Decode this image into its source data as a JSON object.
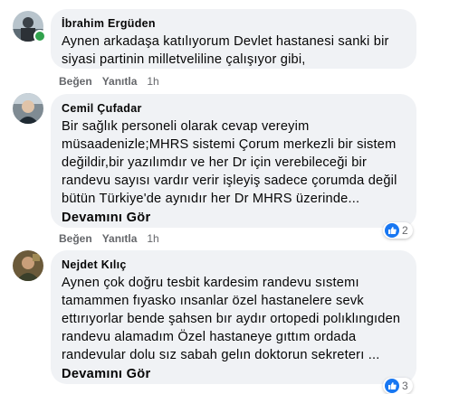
{
  "comments": [
    {
      "author": "İbrahim Ergüden",
      "text": "Aynen arkadaşa katılıyorum Devlet hastanesi sanki bir\nsiyasi partinin milletveliline çalışıyor gibi,",
      "like_label": "Beğen",
      "reply_label": "Yanıtla",
      "time": "1h",
      "online": true
    },
    {
      "author": "Cemil Çufadar",
      "text": "Bir sağlık personeli olarak cevap vereyim\nmüsaadenizle;MHRS sistemi Çorum merkezli bir sistem\ndeğildir,bir yazılımdır ve her Dr için verebileceği bir\nrandevu sayısı vardır verir işleyiş sadece çorumda değil\nbütün Türkiye'de aynıdır her Dr MHRS üzerinde...",
      "see_more": "Devamını Gör",
      "like_label": "Beğen",
      "reply_label": "Yanıtla",
      "time": "1h",
      "reaction_count": "2"
    },
    {
      "author": "Nejdet Kılıç",
      "text": "Aynen çok doğru tesbit kardesim randevu sıstemı\ntamammen fıyasko ınsanlar özel hastanelere sevk\nettırıyorlar bende şahsen bır aydır ortopedi polıklıngıden\nrandevu alamadım Özel hastaneye gıttım ordada\nrandevular dolu sız sabah gelın doktorun sekreterı ...",
      "see_more": "Devamını Gör",
      "reaction_count": "3"
    }
  ],
  "colors": {
    "bubble": "#f0f2f5",
    "meta_text": "#65676b",
    "like_blue": "#1877f2",
    "online_green": "#31a24c"
  }
}
